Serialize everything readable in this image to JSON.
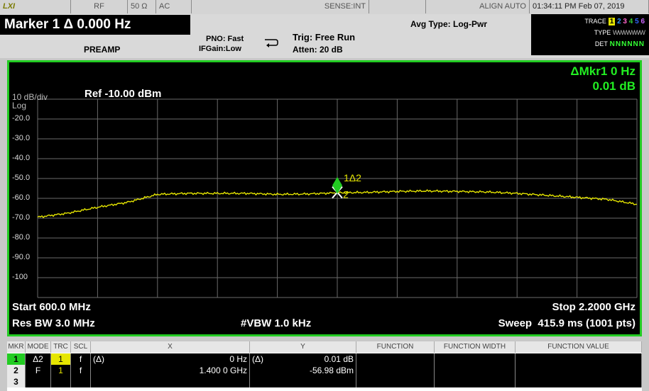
{
  "status_bar": {
    "logo": "LXI",
    "rf": "RF",
    "impedance": "50 Ω",
    "coupling": "AC",
    "sense": "SENSE:INT",
    "align": "ALIGN AUTO",
    "datetime": "01:34:11 PM Feb 07, 2019"
  },
  "header": {
    "marker_title": "Marker 1 Δ 0.000 Hz",
    "preamp": "PREAMP",
    "pno": "PNO: Fast",
    "ifgain": "IFGain:Low",
    "trig": "Trig: Free Run",
    "atten": "Atten: 20 dB",
    "avg_type": "Avg Type: Log-Pwr",
    "trace_label": "TRACE",
    "trace_values": [
      "1",
      "2",
      "3",
      "4",
      "5",
      "6"
    ],
    "type_label": "TYPE",
    "type_values": "WWWWWW",
    "det_label": "DET",
    "det_values": "NNNNNN"
  },
  "plot": {
    "scale": "10 dB/div",
    "scale_mode": "Log",
    "ref_level": "Ref -10.00 dBm",
    "delta_marker_readout": "ΔMkr1 0 Hz",
    "delta_marker_value": "0.01 dB",
    "y_tick_labels": [
      "-20.0",
      "-30.0",
      "-40.0",
      "-50.0",
      "-60.0",
      "-70.0",
      "-80.0",
      "-90.0",
      "-100"
    ],
    "marker1_label": "1Δ2",
    "marker2_label": "2",
    "start_freq": "Start 600.0 MHz",
    "stop_freq": "Stop 2.2000 GHz",
    "res_bw": "Res BW 3.0 MHz",
    "vbw": "#VBW 1.0 kHz",
    "sweep": "Sweep  415.9 ms (1001 pts)",
    "colors": {
      "grid": "#6a6a6a",
      "trace": "#e6e600",
      "frame": "#22cc22",
      "marker": "#22cc22",
      "delta_text": "#22ee22"
    }
  },
  "chart_data": {
    "type": "line",
    "x_unit": "MHz",
    "x_range": [
      600,
      2200
    ],
    "y_unit": "dBm",
    "ylim": [
      -110,
      -10
    ],
    "y_ticks": [
      -20,
      -30,
      -40,
      -50,
      -60,
      -70,
      -80,
      -90,
      -100
    ],
    "grid": true,
    "series": [
      {
        "x": [
          600,
          680,
          760,
          840,
          920,
          1000,
          1080,
          1160,
          1240,
          1320,
          1400,
          1480,
          1560,
          1640,
          1720,
          1800,
          1880,
          1960,
          2040,
          2120,
          2200
        ],
        "values": [
          -69.5,
          -67.5,
          -64.5,
          -62.0,
          -58.0,
          -57.5,
          -57.5,
          -57.5,
          -58.0,
          -57.8,
          -57.2,
          -57.0,
          -56.5,
          -56.3,
          -56.5,
          -56.8,
          -57.5,
          -58.5,
          -59.5,
          -60.5,
          -63.0
        ]
      }
    ],
    "markers": [
      {
        "label": "1Δ2",
        "x": 1400,
        "y": -53.5
      },
      {
        "label": "2",
        "x": 1400,
        "y": -56.98
      }
    ]
  },
  "marker_table": {
    "headers": [
      "MKR",
      "MODE",
      "TRC",
      "SCL",
      "X",
      "Y",
      "FUNCTION",
      "FUNCTION WIDTH",
      "FUNCTION VALUE"
    ],
    "rows": [
      {
        "mkr": "1",
        "mode": "Δ2",
        "trc": "1",
        "scl": "f",
        "xmode": "(Δ)",
        "x": "0 Hz",
        "ymode": "(Δ)",
        "y": "0.01 dB",
        "function": "",
        "function_width": "",
        "function_value": ""
      },
      {
        "mkr": "2",
        "mode": "F",
        "trc": "1",
        "scl": "f",
        "xmode": "",
        "x": "1.400 0 GHz",
        "ymode": "",
        "y": "-56.98 dBm",
        "function": "",
        "function_width": "",
        "function_value": ""
      },
      {
        "mkr": "3",
        "mode": "",
        "trc": "",
        "scl": "",
        "xmode": "",
        "x": "",
        "ymode": "",
        "y": "",
        "function": "",
        "function_width": "",
        "function_value": ""
      }
    ]
  }
}
